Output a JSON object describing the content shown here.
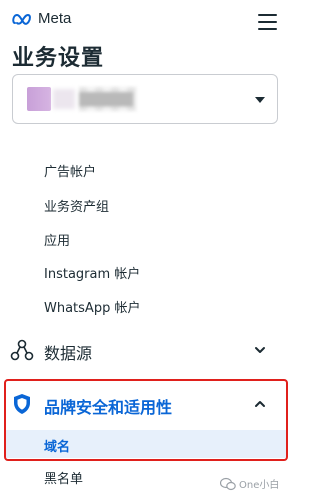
{
  "header": {
    "logo_text": "Meta",
    "menu_icon": "hamburger-icon"
  },
  "page": {
    "title": "业务设置"
  },
  "account_selector": {
    "name": "▇▇▇▇▇",
    "dropdown_icon": "caret-down-icon"
  },
  "accounts_menu": {
    "items": [
      {
        "label": "广告帐户"
      },
      {
        "label": "业务资产组"
      },
      {
        "label": "应用"
      },
      {
        "label": "Instagram 帐户"
      },
      {
        "label": "WhatsApp 帐户"
      }
    ]
  },
  "sections": {
    "data_sources": {
      "label": "数据源",
      "icon": "network-icon",
      "state": "collapsed"
    },
    "brand_safety": {
      "label": "品牌安全和适用性",
      "icon": "shield-icon",
      "state": "expanded",
      "accent": "#0a66d6",
      "items": [
        {
          "label": "域名",
          "active": true
        },
        {
          "label": "黑名单",
          "active": false
        }
      ]
    }
  },
  "watermark": {
    "text": "One小白"
  },
  "colors": {
    "highlight_border": "#e0201c",
    "active_bg": "#e7f0fb",
    "active_text": "#0a66d6",
    "text": "#1c2b33"
  }
}
